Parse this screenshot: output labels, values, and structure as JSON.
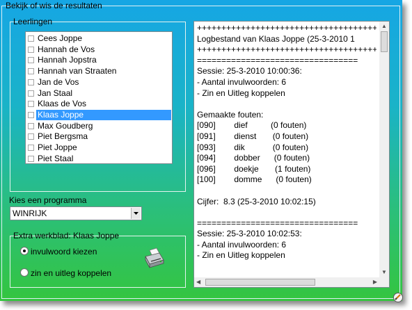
{
  "window": {
    "title": "Bekijk of wis de resultaten"
  },
  "students": {
    "legend": "Leerlingen",
    "items": [
      {
        "label": "Cees Joppe",
        "selected": false
      },
      {
        "label": "Hannah de Vos",
        "selected": false
      },
      {
        "label": "Hannah Jopstra",
        "selected": false
      },
      {
        "label": "Hannah van Straaten",
        "selected": false
      },
      {
        "label": "Jan de Vos",
        "selected": false
      },
      {
        "label": "Jan Staal",
        "selected": false
      },
      {
        "label": "Klaas de Vos",
        "selected": false
      },
      {
        "label": "Klaas Joppe",
        "selected": true
      },
      {
        "label": "Max Goudberg",
        "selected": false
      },
      {
        "label": "Piet Bergsma",
        "selected": false
      },
      {
        "label": "Piet Joppe",
        "selected": false
      },
      {
        "label": "Piet Staal",
        "selected": false
      }
    ]
  },
  "program": {
    "label": "Kies een programma",
    "value": "WINRIJK"
  },
  "extra": {
    "legend": "Extra werkblad: Klaas Joppe",
    "option1": "invulwoord kiezen",
    "option2": "zin en uitleg koppelen",
    "selected": "option1"
  },
  "log": {
    "lines": [
      "++++++++++++++++++++++++++++++++++++++",
      "Logbestand van Klaas Joppe (25-3-2010 1",
      "++++++++++++++++++++++++++++++++++++++",
      "=================================",
      "Sessie: 25-3-2010 10:00:36:",
      "- Aantal invulwoorden: 6",
      "- Zin en Uitleg koppelen",
      "",
      "Gemaakte fouten:",
      "[090]        dief          (0 fouten)",
      "[091]        dienst       (0 fouten)",
      "[093]        dik            (0 fouten)",
      "[094]        dobber      (0 fouten)",
      "[096]        doekje       (1 fouten)",
      "[100]        domme      (0 fouten)",
      "",
      "Cijfer:  8.3 (25-3-2010 10:02:15)",
      "",
      "=================================",
      "Sessie: 25-3-2010 10:02:53:",
      "- Aantal invulwoorden: 6",
      "- Zin en Uitleg koppelen",
      ""
    ]
  },
  "colors": {
    "selection": "#3399ff",
    "gradient_top": "#16a6e4",
    "gradient_bottom": "#34c53f"
  },
  "icons": {
    "print": "printer-icon",
    "close": "close-icon"
  }
}
